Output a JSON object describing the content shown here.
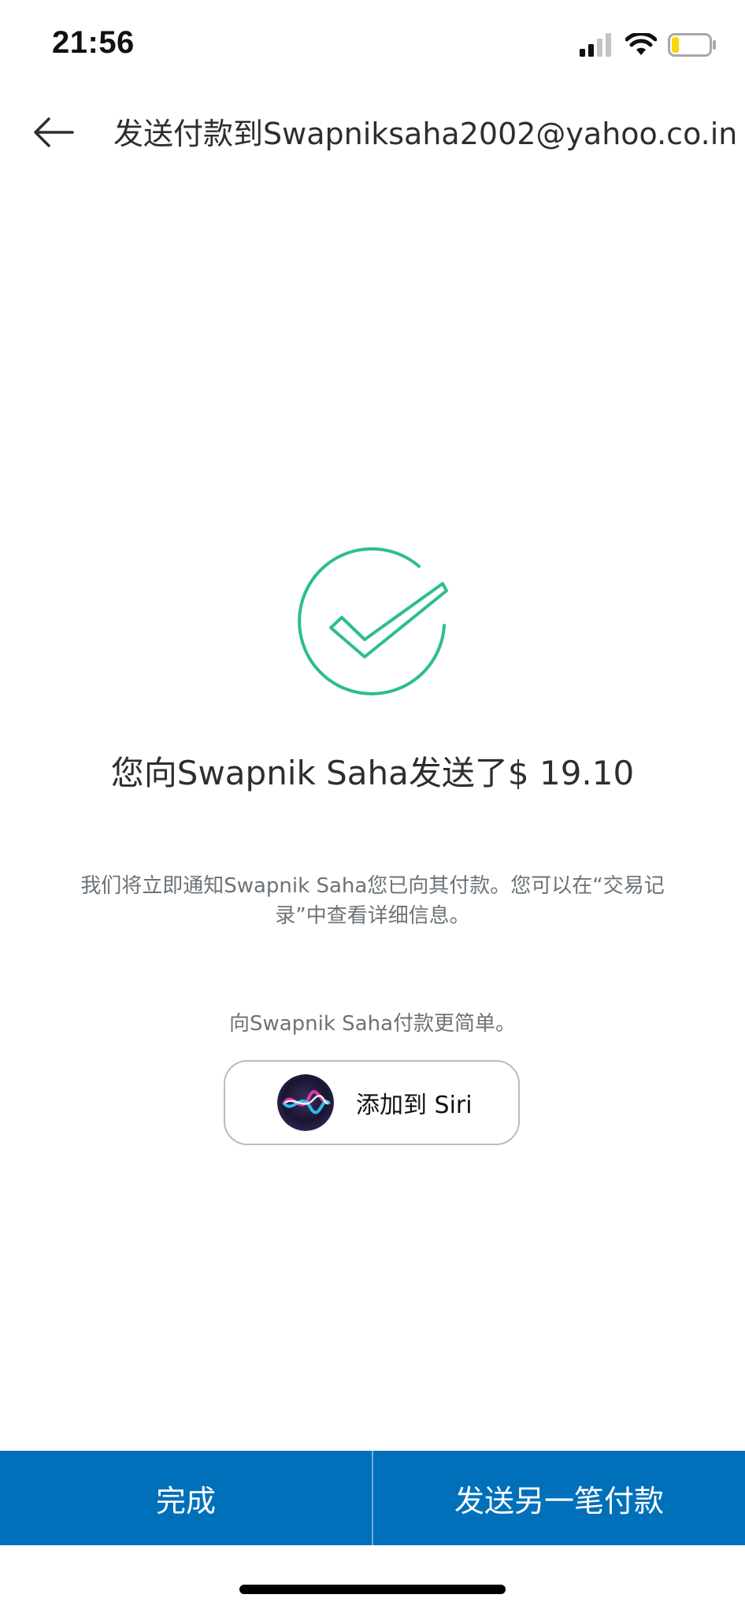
{
  "status_bar": {
    "time": "21:56",
    "icons": [
      "cellular-signal-icon",
      "wifi-icon",
      "battery-icon"
    ],
    "battery_level": 0.2
  },
  "header": {
    "back_icon": "arrow-left-icon",
    "title": "发送付款到Swapniksaha2002@yahoo.co.in"
  },
  "success": {
    "icon": "check-circle-icon",
    "heading": "您向Swapnik Saha发送了$ 19.10",
    "notice": "我们将立即通知Swapnik Saha您已向其付款。您可以在“交易记录”中查看详细信息。"
  },
  "siri": {
    "hint": "向Swapnik Saha付款更简单。",
    "button_label": "添加到 Siri",
    "icon": "siri-icon"
  },
  "actions": {
    "done_label": "完成",
    "send_another_label": "发送另一笔付款"
  },
  "colors": {
    "primary_blue": "#0070ba",
    "success_green": "#2dbe8b",
    "text_dark": "#2c2e2f",
    "text_muted": "#6c7378",
    "battery_yellow": "#f5d90a"
  }
}
